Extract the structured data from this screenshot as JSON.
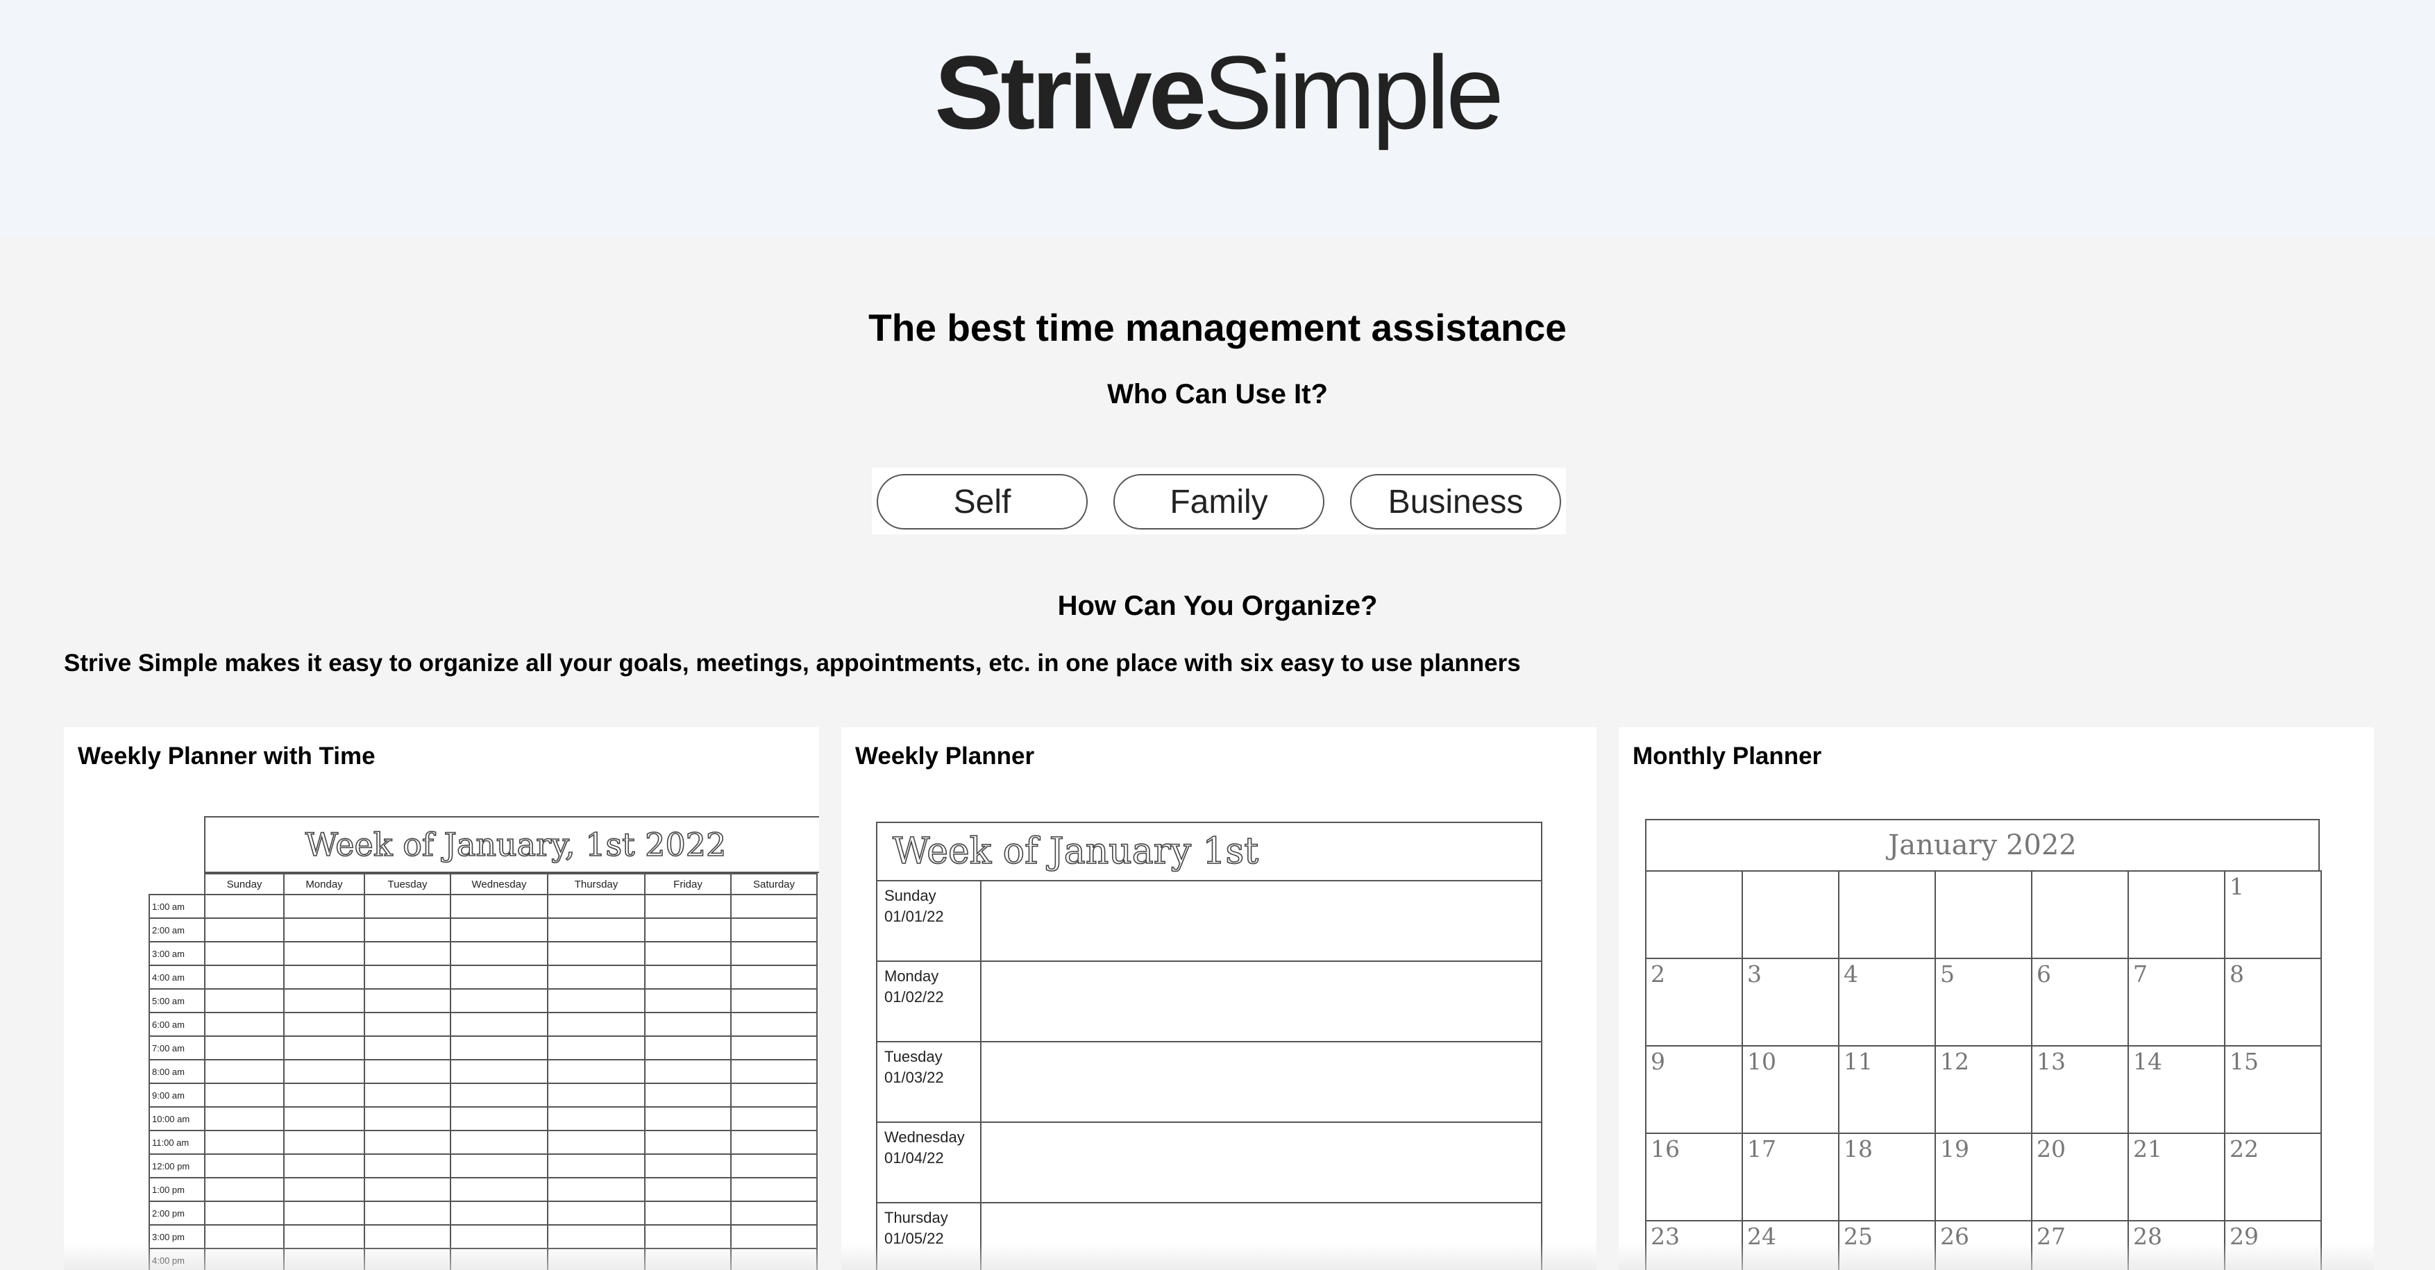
{
  "brand": {
    "strong": "Strive",
    "light": "Simple"
  },
  "hero": {
    "headline": "The best time management assistance",
    "who_heading": "Who Can Use It?"
  },
  "audience_options": [
    "Self",
    "Family",
    "Business"
  ],
  "organize": {
    "heading": "How Can You Organize?",
    "intro": "Strive Simple makes it easy to organize all your goals, meetings, appointments, etc. in one place with six easy to use planners"
  },
  "planners": [
    {
      "title": "Weekly Planner with Time",
      "header": "Week of January, 1st 2022",
      "days": [
        "Sunday",
        "Monday",
        "Tuesday",
        "Wednesday",
        "Thursday",
        "Friday",
        "Saturday"
      ],
      "times": [
        "1:00 am",
        "2:00 am",
        "3:00 am",
        "4:00 am",
        "5:00 am",
        "6:00 am",
        "7:00 am",
        "8:00 am",
        "9:00 am",
        "10:00 am",
        "11:00 am",
        "12:00 pm",
        "1:00 pm",
        "2:00 pm",
        "3:00 pm",
        "4:00 pm"
      ]
    },
    {
      "title": "Weekly Planner",
      "header": "Week of January 1st",
      "rows": [
        {
          "day": "Sunday",
          "date": "01/01/22"
        },
        {
          "day": "Monday",
          "date": "01/02/22"
        },
        {
          "day": "Tuesday",
          "date": "01/03/22"
        },
        {
          "day": "Wednesday",
          "date": "01/04/22"
        },
        {
          "day": "Thursday",
          "date": "01/05/22"
        }
      ]
    },
    {
      "title": "Monthly Planner",
      "header": "January 2022",
      "weeks": [
        [
          "",
          "",
          "",
          "",
          "",
          "",
          "1"
        ],
        [
          "2",
          "3",
          "4",
          "5",
          "6",
          "7",
          "8"
        ],
        [
          "9",
          "10",
          "11",
          "12",
          "13",
          "14",
          "15"
        ],
        [
          "16",
          "17",
          "18",
          "19",
          "20",
          "21",
          "22"
        ],
        [
          "23",
          "24",
          "25",
          "26",
          "27",
          "28",
          "29"
        ]
      ]
    }
  ]
}
